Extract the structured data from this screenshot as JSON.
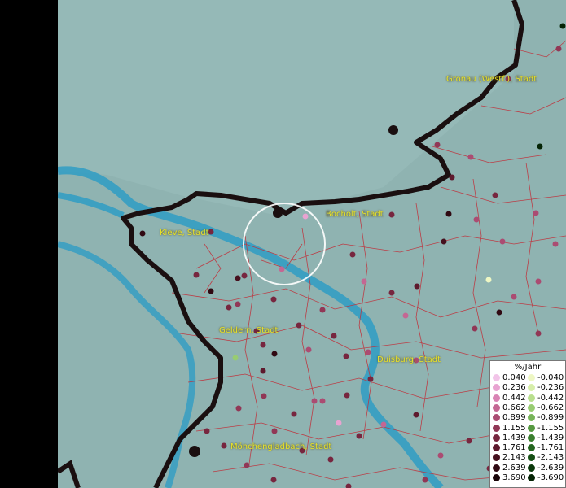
{
  "legend": {
    "title": "%/Jahr",
    "positive": [
      {
        "label": "0.040",
        "color": "#f2c4e8"
      },
      {
        "label": "0.236",
        "color": "#e8a3d1"
      },
      {
        "label": "0.442",
        "color": "#d983b4"
      },
      {
        "label": "0.662",
        "color": "#c46793"
      },
      {
        "label": "0.899",
        "color": "#ab4c72"
      },
      {
        "label": "1.155",
        "color": "#913756"
      },
      {
        "label": "1.439",
        "color": "#77263f"
      },
      {
        "label": "1.761",
        "color": "#5e192d"
      },
      {
        "label": "2.143",
        "color": "#46101e"
      },
      {
        "label": "2.639",
        "color": "#300912"
      },
      {
        "label": "3.690",
        "color": "#1a0408"
      }
    ],
    "negative": [
      {
        "label": "-0.040",
        "color": "#eef7c4"
      },
      {
        "label": "-0.236",
        "color": "#d7eeaa"
      },
      {
        "label": "-0.442",
        "color": "#b9df8e"
      },
      {
        "label": "-0.662",
        "color": "#98cc72"
      },
      {
        "label": "-0.899",
        "color": "#77b459"
      },
      {
        "label": "-1.155",
        "color": "#579a42"
      },
      {
        "label": "-1.439",
        "color": "#3b7f2f"
      },
      {
        "label": "-1.761",
        "color": "#256620"
      },
      {
        "label": "-2.143",
        "color": "#164f15"
      },
      {
        "label": "-2.639",
        "color": "#0b390c"
      },
      {
        "label": "-3.690",
        "color": "#042405"
      }
    ]
  },
  "cities": [
    {
      "name": "Gronau (Westf.), Stadt"
    },
    {
      "name": "Bocholt, Stadt"
    },
    {
      "name": "Kleve, Stadt"
    },
    {
      "name": "Geldern, Stadt"
    },
    {
      "name": "Duisburg, Stadt"
    },
    {
      "name": "Mönchengladbach, Stadt"
    }
  ],
  "colors": {
    "land": "#8fb3b1",
    "water": "#2f9cc4",
    "border": "#1a0f10",
    "district_lines": "#c0303a"
  }
}
